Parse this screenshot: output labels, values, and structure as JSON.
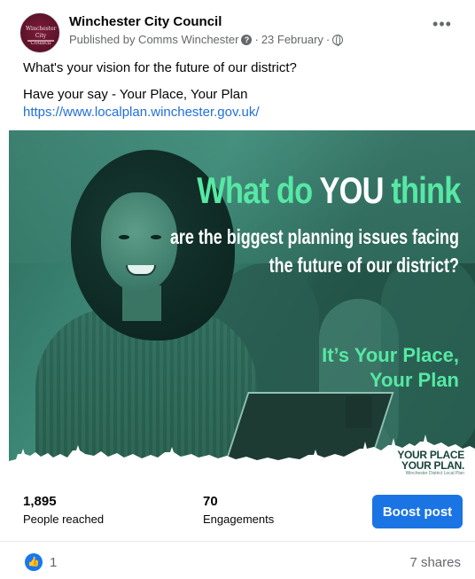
{
  "header": {
    "page_name": "Winchester City Council",
    "published_by": "Published by Comms Winchester",
    "date": "23 February",
    "sep": "·",
    "avatar_text": "Winchester City Council",
    "more_label": "•••"
  },
  "post": {
    "line1": "What's your vision for the future of our district?",
    "line2": "Have your say - Your Place, Your Plan",
    "link": "https://www.localplan.winchester.gov.uk/"
  },
  "image": {
    "headline_a": "What do ",
    "headline_you": "YOU",
    "headline_b": " think",
    "sub1": "are the biggest planning issues facing",
    "sub2": "the future of our district?",
    "tag1": "It’s Your Place,",
    "tag2": "Your Plan",
    "logo1": "YOUR PLACE",
    "logo2": "YOUR PLAN.",
    "logo3": "Winchester District Local Plan"
  },
  "stats": {
    "reached_value": "1,895",
    "reached_label": "People reached",
    "engagements_value": "70",
    "engagements_label": "Engagements",
    "boost_label": "Boost post"
  },
  "footer": {
    "likes": "1",
    "shares": "7 shares"
  },
  "colors": {
    "accent": "#1b74e4",
    "image_green": "#56e8a4",
    "image_bg": "#2c6a5c"
  },
  "icons": [
    "help-icon",
    "globe-icon",
    "more-icon",
    "like-icon"
  ]
}
